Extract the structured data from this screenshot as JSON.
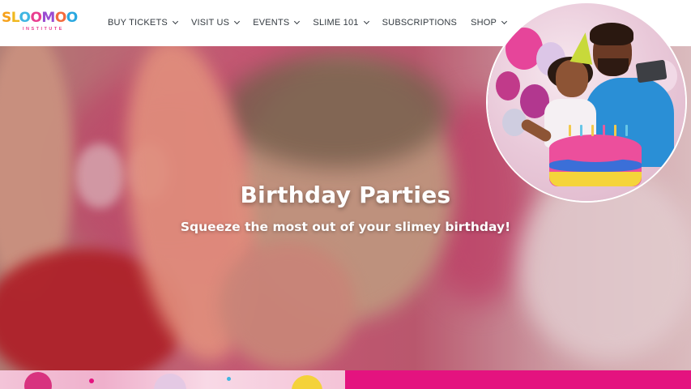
{
  "brand": {
    "logo_text": "SLOOMOO",
    "logo_subtext": "INSTITUTE"
  },
  "nav": {
    "items": [
      {
        "label": "BUY TICKETS",
        "has_dropdown": true
      },
      {
        "label": "VISIT US",
        "has_dropdown": true
      },
      {
        "label": "EVENTS",
        "has_dropdown": true
      },
      {
        "label": "SLIME 101",
        "has_dropdown": true
      },
      {
        "label": "SUBSCRIPTIONS",
        "has_dropdown": false
      },
      {
        "label": "SHOP",
        "has_dropdown": true
      }
    ]
  },
  "hero": {
    "title": "Birthday Parties",
    "subtitle": "Squeeze the most out of your slimey birthday!"
  },
  "colors": {
    "accent_pink": "#e4137f",
    "nav_text": "#333a40",
    "cake_pink": "#ec4f9c",
    "cake_blue": "#3b6fd8",
    "cake_yellow": "#f5d43a"
  }
}
